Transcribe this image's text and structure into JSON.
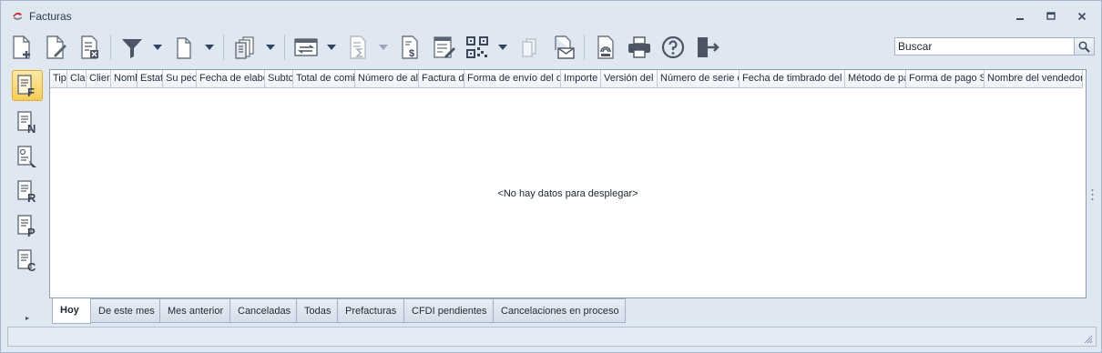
{
  "window": {
    "title": "Facturas"
  },
  "window_controls": {
    "minimize": "–",
    "restore": "▫",
    "close": "✕"
  },
  "toolbar": {
    "items": [
      {
        "icon": "new-document-icon",
        "dropdown": false
      },
      {
        "icon": "edit-document-icon",
        "dropdown": false
      },
      {
        "icon": "delete-document-icon",
        "dropdown": false
      },
      {
        "icon": "filter-icon",
        "dropdown": true
      },
      {
        "icon": "copy-document-icon",
        "dropdown": true
      },
      {
        "icon": "print-copies-icon",
        "dropdown": true
      },
      {
        "icon": "window-transfer-icon",
        "dropdown": true
      },
      {
        "icon": "sum-document-icon",
        "dropdown": true,
        "disabled": true
      },
      {
        "icon": "payment-document-icon",
        "dropdown": false
      },
      {
        "icon": "edit-list-icon",
        "dropdown": false
      },
      {
        "icon": "qr-code-icon",
        "dropdown": true
      },
      {
        "icon": "copy-pages-icon",
        "dropdown": false,
        "disabled": true
      },
      {
        "icon": "email-document-icon",
        "dropdown": false
      },
      {
        "icon": "cfdi-stamp-icon",
        "dropdown": false
      },
      {
        "icon": "printer-icon",
        "dropdown": false
      },
      {
        "icon": "help-icon",
        "dropdown": false
      },
      {
        "icon": "exit-icon",
        "dropdown": false
      }
    ]
  },
  "search": {
    "value": "Buscar",
    "icon": "search-icon"
  },
  "sidebar": {
    "items": [
      {
        "letter": "F",
        "active": true
      },
      {
        "letter": "N",
        "active": false
      },
      {
        "letter": "",
        "active": false
      },
      {
        "letter": "R",
        "active": false
      },
      {
        "letter": "P",
        "active": false
      },
      {
        "letter": "C",
        "active": false
      }
    ],
    "expander": "▸"
  },
  "grid": {
    "columns": [
      "Tip",
      "Cla",
      "Clier",
      "Noml",
      "Estat",
      "Su pec",
      "Fecha de elabo",
      "Subtc",
      "Total de comi",
      "Número de alı",
      "Factura d",
      "Forma de envío del d",
      "Importe",
      "Versión del l",
      "Número de serie c",
      "Fecha de timbrado del c",
      "Método de pa",
      "Forma de pago S",
      "Nombre del vendedor"
    ],
    "empty_message": "<No hay datos para desplegar>"
  },
  "tabs": [
    {
      "label": "Hoy",
      "active": true
    },
    {
      "label": "De este mes",
      "active": false
    },
    {
      "label": "Mes anterior",
      "active": false
    },
    {
      "label": "Canceladas",
      "active": false
    },
    {
      "label": "Todas",
      "active": false
    },
    {
      "label": "Prefacturas",
      "active": false
    },
    {
      "label": "CFDI pendientes",
      "active": false
    },
    {
      "label": "Cancelaciones en proceso",
      "active": false
    }
  ]
}
